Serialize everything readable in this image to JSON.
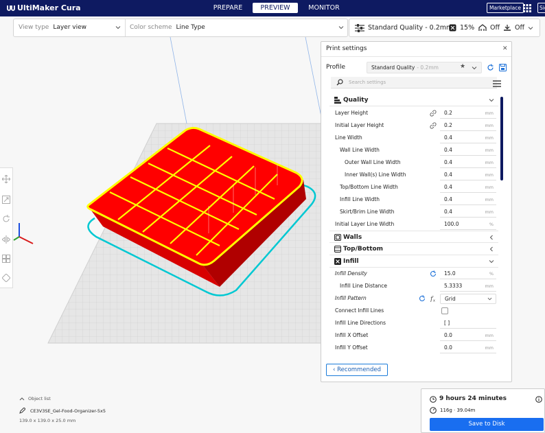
{
  "app": {
    "title": "UltiMaker Cura"
  },
  "stages": {
    "prepare": "PREPARE",
    "preview": "PREVIEW",
    "monitor": "MONITOR"
  },
  "header": {
    "marketplace": "Marketplace",
    "signin": "Sign in"
  },
  "view_bar": {
    "view_type_label": "View type",
    "view_type_value": "Layer view",
    "color_scheme_label": "Color scheme",
    "color_scheme_value": "Line Type"
  },
  "quality_bar": {
    "profile": "Standard Quality - 0.2mm",
    "infill": "15%",
    "support": "Off",
    "adhesion": "Off"
  },
  "panel": {
    "title": "Print settings",
    "profile_label": "Profile",
    "profile_value": "Standard Quality",
    "profile_sub": "- 0.2mm",
    "search_placeholder": "Search settings",
    "recommended_label": "Recommended"
  },
  "categories": {
    "quality": "Quality",
    "walls": "Walls",
    "top_bottom": "Top/Bottom",
    "infill": "Infill"
  },
  "settings": [
    {
      "label": "Layer Height",
      "value": "0.2",
      "unit": "mm"
    },
    {
      "label": "Initial Layer Height",
      "value": "0.2",
      "unit": "mm"
    },
    {
      "label": "Line Width",
      "value": "0.4",
      "unit": "mm"
    },
    {
      "label": "Wall Line Width",
      "value": "0.4",
      "unit": "mm"
    },
    {
      "label": "Outer Wall Line Width",
      "value": "0.4",
      "unit": "mm"
    },
    {
      "label": "Inner Wall(s) Line Width",
      "value": "0.4",
      "unit": "mm"
    },
    {
      "label": "Top/Bottom Line Width",
      "value": "0.4",
      "unit": "mm"
    },
    {
      "label": "Infill Line Width",
      "value": "0.4",
      "unit": "mm"
    },
    {
      "label": "Skirt/Brim Line Width",
      "value": "0.4",
      "unit": "mm"
    },
    {
      "label": "Initial Layer Line Width",
      "value": "100.0",
      "unit": "%"
    },
    {
      "label": "Infill Density",
      "value": "15.0",
      "unit": "%"
    },
    {
      "label": "Infill Line Distance",
      "value": "5.3333",
      "unit": "mm"
    },
    {
      "label": "Infill Pattern",
      "value": "Grid",
      "unit": ""
    },
    {
      "label": "Connect Infill Lines",
      "value": "",
      "unit": ""
    },
    {
      "label": "Infill Line Directions",
      "value": "[ ]",
      "unit": ""
    },
    {
      "label": "Infill X Offset",
      "value": "0.0",
      "unit": "mm"
    },
    {
      "label": "Infill Y Offset",
      "value": "0.0",
      "unit": "mm"
    }
  ],
  "object_list": {
    "label": "Object list",
    "name": "CE3V3SE_Gel-Food-Organizer-5x5",
    "dimensions": "139.0 x 139.0 x 25.0 mm"
  },
  "job": {
    "time": "9 hours 24 minutes",
    "material": "116g · 39.04m",
    "save_label": "Save to Disk"
  },
  "colors": {
    "header": "#0e1a61",
    "accent": "#196ef0",
    "model": "#ff0000",
    "infill": "#ffff00",
    "skirt": "#00c8d2"
  }
}
